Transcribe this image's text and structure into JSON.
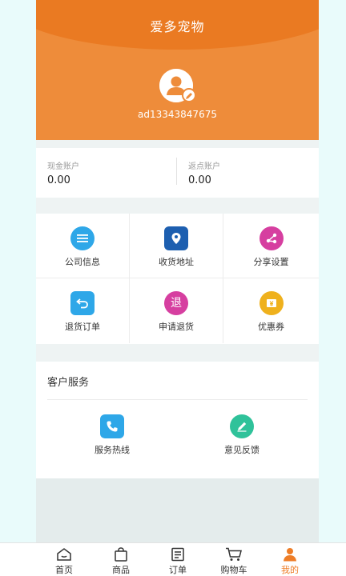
{
  "header": {
    "title": "爱多宠物",
    "username": "ad13343847675"
  },
  "accounts": [
    {
      "label": "现金账户",
      "value": "0.00"
    },
    {
      "label": "返点账户",
      "value": "0.00"
    }
  ],
  "grid": [
    {
      "label": "公司信息",
      "icon": "list-icon",
      "color": "#2ea7e8"
    },
    {
      "label": "收货地址",
      "icon": "location-pin-icon",
      "color": "#1d5fb0"
    },
    {
      "label": "分享设置",
      "icon": "share-icon",
      "color": "#d63fa0"
    },
    {
      "label": "退货订单",
      "icon": "return-arrow-icon",
      "color": "#2ea7e8"
    },
    {
      "label": "申请退货",
      "icon_text": "退",
      "icon": "refund-icon",
      "color": "#d63fa0"
    },
    {
      "label": "优惠券",
      "icon": "coupon-icon",
      "color": "#efb11d"
    }
  ],
  "service": {
    "title": "客户服务",
    "items": [
      {
        "label": "服务热线",
        "icon": "phone-icon",
        "color": "#2ea7e8"
      },
      {
        "label": "意见反馈",
        "icon": "pencil-icon",
        "color": "#2fc29a"
      }
    ]
  },
  "tabbar": [
    {
      "label": "首页",
      "icon": "home-icon"
    },
    {
      "label": "商品",
      "icon": "bag-icon"
    },
    {
      "label": "订单",
      "icon": "order-icon"
    },
    {
      "label": "购物车",
      "icon": "cart-icon"
    },
    {
      "label": "我的",
      "icon": "user-icon",
      "active": true
    }
  ],
  "colors": {
    "brand": "#ee8c3a",
    "active_tab": "#ee7d27"
  }
}
